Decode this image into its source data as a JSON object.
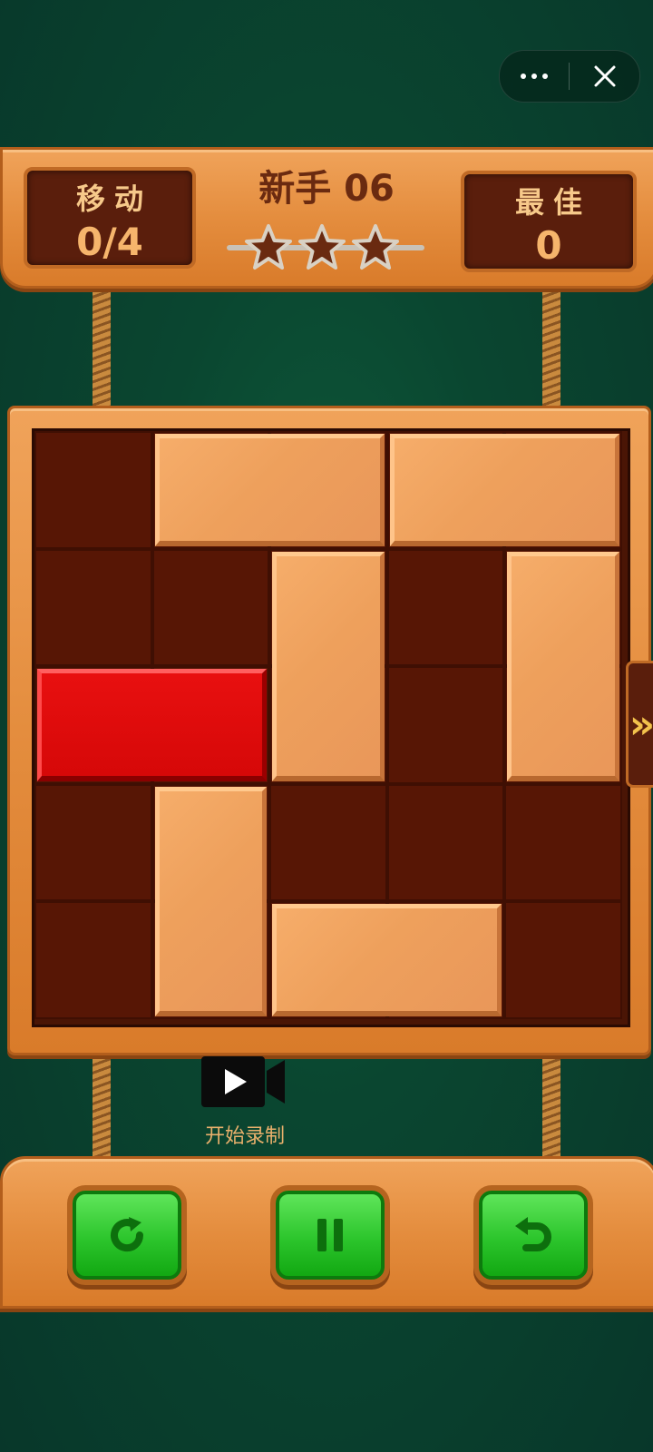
{
  "window": {
    "more_icon": "more-dots-icon",
    "close_icon": "close-icon"
  },
  "header": {
    "moves_label": "移动",
    "moves_value": "0/4",
    "level_title": "新手 06",
    "best_label": "最佳",
    "best_value": "0",
    "stars_total": 3,
    "stars_earned": 0
  },
  "board": {
    "rows": 5,
    "cols": 5,
    "exit_icon": "»",
    "blocks": [
      {
        "id": "target-block",
        "row": 2,
        "col": 0,
        "rows": 1,
        "cols": 2,
        "color": "red"
      },
      {
        "id": "wood-block-1",
        "row": 0,
        "col": 1,
        "rows": 1,
        "cols": 2,
        "color": "wood"
      },
      {
        "id": "wood-block-2",
        "row": 0,
        "col": 3,
        "rows": 1,
        "cols": 2,
        "color": "wood"
      },
      {
        "id": "wood-block-3",
        "row": 1,
        "col": 2,
        "rows": 2,
        "cols": 1,
        "color": "wood"
      },
      {
        "id": "wood-block-4",
        "row": 1,
        "col": 4,
        "rows": 2,
        "cols": 1,
        "color": "wood"
      },
      {
        "id": "wood-block-5",
        "row": 3,
        "col": 1,
        "rows": 2,
        "cols": 1,
        "color": "wood"
      },
      {
        "id": "wood-block-6",
        "row": 4,
        "col": 2,
        "rows": 1,
        "cols": 2,
        "color": "wood"
      }
    ]
  },
  "record": {
    "label": "开始录制",
    "icon": "video-camera-icon"
  },
  "controls": [
    {
      "name": "restart-button",
      "icon": "restart-icon"
    },
    {
      "name": "pause-button",
      "icon": "pause-icon"
    },
    {
      "name": "undo-button",
      "icon": "undo-icon"
    }
  ],
  "colors": {
    "red_block": "#d60808",
    "wood_block": "#eea05c",
    "board": "#571605",
    "background": "#0a4630",
    "button_green": "#2cc52c"
  }
}
